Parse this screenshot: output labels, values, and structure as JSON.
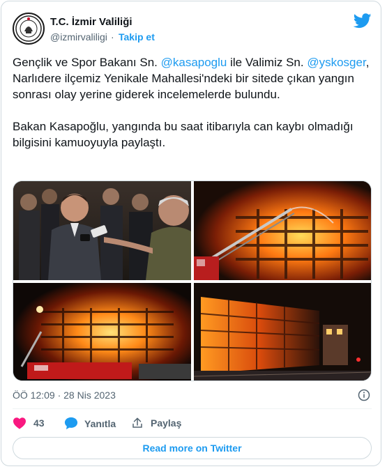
{
  "author": {
    "name": "T.C. İzmir Valiliği",
    "handle": "@izmirvaliligi",
    "separator": "·",
    "follow_label": "Takip et"
  },
  "tweet": {
    "p1_a": "Gençlik ve Spor Bakanı Sn. ",
    "p1_m1": "@kasapoglu",
    "p1_b": " ile Valimiz Sn. ",
    "p1_m2": "@yskosger",
    "p1_c": ", Narlıdere ilçemiz Yenikale Mahallesi'ndeki bir sitede çıkan yangın sonrası olay yerine giderek incelemelerde bulundu.",
    "p2": "Bakan Kasapoğlu, yangında bu saat itibarıyla can kaybı olmadığı bilgisini kamuoyuyla paylaştı."
  },
  "media": [
    {
      "alt": "minister-speaking-to-press"
    },
    {
      "alt": "fire-ladder-spraying-building"
    },
    {
      "alt": "burning-building-night"
    },
    {
      "alt": "burning-building-street"
    }
  ],
  "meta": {
    "timestamp": "ÖÖ 12:09 · 28 Nis 2023"
  },
  "actions": {
    "like_count": "43",
    "reply_label": "Yanıtla",
    "share_label": "Paylaş"
  },
  "read_more_label": "Read more on Twitter",
  "colors": {
    "accent": "#1d9bf0",
    "like": "#f91880",
    "muted": "#536471",
    "border": "#cfd9de"
  },
  "icons": [
    "twitter-bird-icon",
    "heart-icon",
    "reply-bubble-icon",
    "share-icon",
    "info-icon",
    "avatar-seal-icon"
  ]
}
